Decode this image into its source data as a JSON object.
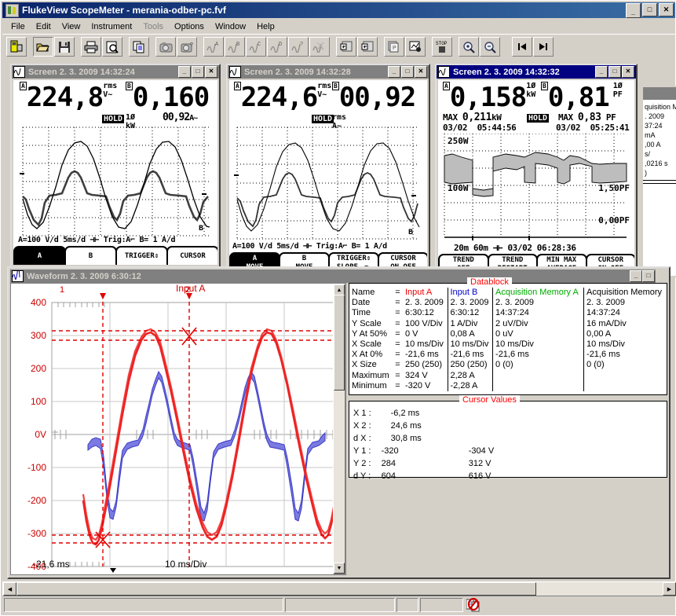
{
  "window": {
    "title": "FlukeView ScopeMeter - merania-odber-pc.fvf",
    "icon": "flukeview-app-icon",
    "minimize": "_",
    "maximize": "□",
    "close": "✕"
  },
  "menu": [
    {
      "label": "File",
      "enabled": true
    },
    {
      "label": "Edit",
      "enabled": true
    },
    {
      "label": "View",
      "enabled": true
    },
    {
      "label": "Instrument",
      "enabled": true
    },
    {
      "label": "Tools",
      "enabled": false
    },
    {
      "label": "Options",
      "enabled": true
    },
    {
      "label": "Window",
      "enabled": true
    },
    {
      "label": "Help",
      "enabled": true
    }
  ],
  "toolbar": [
    {
      "name": "connect-instrument",
      "group": 0
    },
    {
      "name": "open-file",
      "group": 1
    },
    {
      "name": "save-file",
      "group": 1
    },
    {
      "name": "print",
      "group": 2
    },
    {
      "name": "print-preview",
      "group": 2
    },
    {
      "name": "copy",
      "group": 3
    },
    {
      "name": "capture-screen",
      "group": 4
    },
    {
      "name": "capture-screen-query",
      "group": 4
    },
    {
      "name": "waveform-a",
      "group": 5,
      "label": "A"
    },
    {
      "name": "waveform-b",
      "group": 5,
      "label": "B"
    },
    {
      "name": "waveform-c",
      "group": 5,
      "label": "C"
    },
    {
      "name": "waveform-d",
      "group": 5,
      "label": "D"
    },
    {
      "name": "waveform-query",
      "group": 5,
      "label": "?"
    },
    {
      "name": "waveform-all",
      "group": 5
    },
    {
      "name": "import-left",
      "group": 6
    },
    {
      "name": "import-right",
      "group": 6
    },
    {
      "name": "copy-pages",
      "group": 7
    },
    {
      "name": "chart-record",
      "group": 7
    },
    {
      "name": "stop",
      "group": 8,
      "label": "STOP"
    },
    {
      "name": "zoom-in",
      "group": 9
    },
    {
      "name": "zoom-out",
      "group": 9
    },
    {
      "name": "first-page",
      "group": 10
    },
    {
      "name": "last-page",
      "group": 10
    }
  ],
  "screens": [
    {
      "title": "Screen  2. 3. 2009  14:32:24",
      "active": false,
      "readingA": {
        "channel": "A",
        "value": "224,8",
        "unit_top": "rms",
        "unit_bot": "V~"
      },
      "readingB": {
        "channel": "B",
        "value": "0,160",
        "unit_top": "1Ø",
        "unit_bot": "kW"
      },
      "sub": "00,92",
      "sub_unit": "A~",
      "hold": "HOLD",
      "footer": "A=100 V/d      5ms/d   ⊣⊢ Trig:A⌐   B=   1 A/d",
      "settings": {
        "range_a": "A=100 V/d",
        "timebase": "5ms/d",
        "trigger": "Trig:A",
        "range_b": "B=   1 A/d"
      },
      "softkeys": [
        {
          "l1": "A",
          "l2": "",
          "state": "on",
          "glyph": "▲▼"
        },
        {
          "l1": "B",
          "l2": "",
          "state": "off",
          "glyph": "▲▼"
        },
        {
          "l1": "TRIGGER⇕",
          "l2": "",
          "state": "off"
        },
        {
          "l1": "CURSOR",
          "l2": "",
          "state": "off"
        }
      ],
      "markerB": "B"
    },
    {
      "title": "Screen  2. 3. 2009  14:32:28",
      "active": false,
      "readingA": {
        "channel": "A",
        "value": "224,6",
        "unit_top": "rms",
        "unit_bot": "V~"
      },
      "readingB": {
        "channel": "B",
        "value": "00,92",
        "unit_top": "rms",
        "unit_bot": "A~"
      },
      "sub": "",
      "sub_unit": "",
      "hold": "HOLD",
      "footer": "A=100 V/d      5ms/d   ⊣⊢ Trig:A⌐   B=   1 A/d",
      "settings": {
        "range_a": "A=100 V/d",
        "timebase": "5ms/d",
        "trigger": "Trig:A",
        "range_b": "B=   1 A/d"
      },
      "softkeys": [
        {
          "l1": "A",
          "l2": "MOVE",
          "state": "on",
          "glyph": "✥"
        },
        {
          "l1": "B",
          "l2": "MOVE",
          "state": "off",
          "glyph": "✥"
        },
        {
          "l1": "TRIGGER⇕",
          "l2": "SLOPE  ◄►",
          "state": "off"
        },
        {
          "l1": "CURSOR",
          "l2": "ON   OFF",
          "state": "off",
          "highlight": "OFF"
        }
      ],
      "markerB": "B"
    },
    {
      "title": "Screen  2. 3. 2009  14:32:32",
      "active": true,
      "readingA": {
        "channel": "A",
        "value": "0,158",
        "unit_top": "1Ø",
        "unit_bot": "kW"
      },
      "readingB": {
        "channel": "B",
        "value": "0,81",
        "unit_top": "1Ø",
        "unit_bot": "PF"
      },
      "maxA": {
        "label": "MAX",
        "value": "0,211",
        "unit": "kW",
        "date": "03/02",
        "time": "05:44:56"
      },
      "maxB": {
        "label": "MAX",
        "value": "0,83",
        "unit": "PF",
        "date": "03/02",
        "time": "05:25:41"
      },
      "hold": "HOLD",
      "scale_top_left": "250W",
      "scale_bot_left": "100W",
      "scale_top_right": "1,50PF",
      "scale_bot_right": "0,00PF",
      "footer": "20m             60m  ⊣⊢ 03/02  06:28:36",
      "axis": {
        "t1": "20m",
        "t2": "60m",
        "date": "03/02",
        "time": "06:28:36"
      },
      "softkeys": [
        {
          "l1": "TREND",
          "l2": "OFF",
          "state": "off"
        },
        {
          "l1": "TREND",
          "l2": "RESTART",
          "state": "off"
        },
        {
          "l1": "MIN MAX",
          "l2": "AVERAGE",
          "state": "off",
          "highlight": "MAX"
        },
        {
          "l1": "CURSOR",
          "l2": "ON   OFF",
          "state": "off",
          "highlight": "OFF"
        }
      ]
    }
  ],
  "waveform_window": {
    "title": "Waveform  2. 3. 2009  6:30:12",
    "cursor1_label": "1",
    "cursor2_label": "2",
    "trace_label": "Input A",
    "x_left_label": "-21,6 ms",
    "x_div_label": "10 ms/Div"
  },
  "chart_data": {
    "type": "line",
    "title": "Waveform  2. 3. 2009  6:30:12",
    "xlabel": "10 ms/Div",
    "ylabel": "V",
    "ylim": [
      -400,
      400
    ],
    "yticks": [
      400,
      300,
      200,
      100,
      0,
      -100,
      -200,
      -300,
      -400
    ],
    "ytick_labels": [
      "400",
      "300",
      "200",
      "100",
      "0V",
      "-100",
      "-200",
      "-300",
      "-400"
    ],
    "xlim_ms": [
      -21.6,
      28.4
    ],
    "x_start_ms": -21.6,
    "x_per_div_ms": 10,
    "grid": true,
    "legend": "none",
    "annotations": [
      {
        "name": "cursor-1",
        "type": "vline",
        "x_ms": -6.2,
        "label": "1",
        "color": "#e00000"
      },
      {
        "name": "cursor-2",
        "type": "vline",
        "x_ms": 24.6,
        "label": "2",
        "color": "#e00000"
      },
      {
        "name": "cursor-y1-low",
        "type": "hline",
        "y": -320,
        "color": "#e00000"
      },
      {
        "name": "cursor-y1-high",
        "type": "hline",
        "y": -304,
        "color": "#e00000"
      },
      {
        "name": "cursor-y2-low",
        "type": "hline",
        "y": 284,
        "color": "#e00000"
      },
      {
        "name": "cursor-y2-high",
        "type": "hline",
        "y": 312,
        "color": "#e00000"
      }
    ],
    "series": [
      {
        "name": "Input A",
        "color": "#ee0000",
        "unit": "V",
        "scale": "100 V/Div",
        "max": 324,
        "min": -320
      },
      {
        "name": "Input B",
        "color": "#4646dc",
        "unit": "A",
        "scale": "1 A/Div",
        "max": 2.28,
        "min": -2.28
      }
    ]
  },
  "datablock": {
    "legend": "Datablock",
    "row_labels": [
      "Name",
      "Date",
      "Time",
      "Y Scale",
      "Y At 50%",
      "X Scale",
      "X At 0%",
      "X Size",
      "Maximum",
      "Minimum"
    ],
    "eq": "=",
    "columns": [
      {
        "header": "Input A",
        "color": "#ee0000",
        "values": [
          "2. 3. 2009",
          "6:30:12",
          "100    V/Div",
          "0     V",
          "10    ms/Div",
          "-21,6 ms",
          "250 (250)",
          "324    V",
          "-320   V"
        ]
      },
      {
        "header": "Input B",
        "color": "#0000cc",
        "values": [
          "2. 3. 2009",
          "6:30:12",
          "1     A/Div",
          "0,08 A",
          "10    ms/Div",
          "-21,6  ms",
          "250 (250)",
          "2,28 A",
          "-2,28 A"
        ]
      },
      {
        "header": "Acquisition Memory A",
        "color": "#00aa00",
        "values": [
          "2. 3. 2009",
          "14:37:24",
          "2    uV/Div",
          "0   uV",
          "10   ms/Div",
          "-21,6 ms",
          "0 (0)",
          "",
          ""
        ]
      },
      {
        "header": "Acquisition Memory",
        "color": "#000000",
        "values": [
          "2. 3. 2009",
          "14:37:24",
          "16    mA/Div",
          "0,00 A",
          "10    ms/Div",
          "-21,6  ms",
          "0 (0)",
          "",
          ""
        ]
      }
    ]
  },
  "cursor_values": {
    "legend": "Cursor Values",
    "rows": [
      {
        "label": "X 1 :",
        "v1": "-6,2 ms",
        "v2": ""
      },
      {
        "label": "X 2 :",
        "v1": "24,6 ms",
        "v2": ""
      },
      {
        "label": "d X :",
        "v1": "30,8 ms",
        "v2": ""
      },
      {
        "label": "Y 1 :",
        "v1": "-320",
        "v2": "-304 V"
      },
      {
        "label": "Y 2 :",
        "v1": "284",
        "v2": "312 V"
      },
      {
        "label": "d Y :",
        "v1": "604",
        "v2": "616 V"
      }
    ]
  },
  "background_window": {
    "lines": [
      "quisition M",
      ". 2009",
      "37:24",
      "           mA",
      ",00    A",
      "           s/",
      ",0216 s",
      ")"
    ]
  },
  "statusbar": {
    "panel1": "",
    "panel2": "",
    "panel3": "",
    "panel4": "",
    "icon": "no-connection-icon"
  }
}
